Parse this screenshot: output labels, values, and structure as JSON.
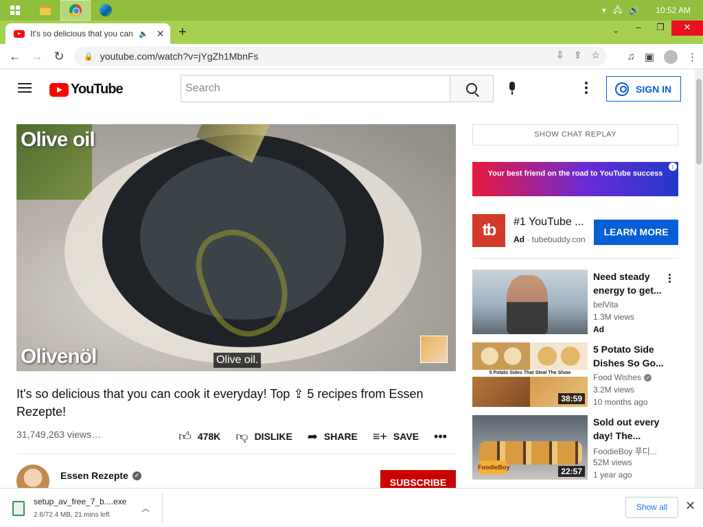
{
  "taskbar": {
    "time": "10:52 AM"
  },
  "browser": {
    "tab_title": "It's so delicious that you can",
    "url": "youtube.com/watch?v=jYgZh1MbnFs"
  },
  "youtube": {
    "logo_text": "YouTube",
    "search_placeholder": "Search",
    "signin_label": "SIGN IN"
  },
  "video": {
    "overlay_top": "Olive oil",
    "overlay_bottom": "Olivenöl",
    "caption": "Olive oil.",
    "title": "It's so delicious that you can cook it everyday! Top ⇪ 5 recipes from Essen Rezepte!",
    "views": "31,749,263 views…",
    "likes": "478K",
    "dislike_label": "DISLIKE",
    "share_label": "SHARE",
    "save_label": "SAVE",
    "channel_name": "Essen Rezepte",
    "subscribe_label": "SUBSCRIBE"
  },
  "sidebar": {
    "chat_replay": "SHOW CHAT REPLAY",
    "banner_text": "Your best friend on the road to YouTube success",
    "ad": {
      "logo": "tb",
      "title": "#1 YouTube ...",
      "ad_label": "Ad",
      "domain": "tubebuddy.con",
      "cta": "LEARN MORE"
    },
    "recommendations": [
      {
        "title": "Need steady energy to get...",
        "channel": "belVita",
        "views": "1.3M views",
        "extra": "Ad"
      },
      {
        "title": "5 Potato Side Dishes So Go...",
        "channel": "Food Wishes",
        "views": "3.2M views",
        "age": "10 months ago",
        "duration": "38:59",
        "thumb_text": "5 Potato Sides That Steal The Show"
      },
      {
        "title": "Sold out every day! The...",
        "channel": "FoodieBoy 푸디...",
        "views": "52M views",
        "age": "1 year ago",
        "duration": "22:57",
        "thumb_text": "FoodieBoy"
      }
    ]
  },
  "downloads": {
    "filename": "setup_av_free_7_b....exe",
    "status": "2.6/72.4 MB, 21 mins left",
    "show_all": "Show all"
  }
}
